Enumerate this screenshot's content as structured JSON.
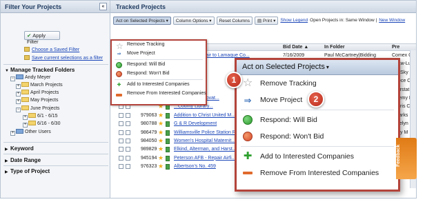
{
  "sidebar": {
    "title": "Filter Your Projects",
    "collapse_glyph": "«",
    "apply_label": "Apply Filter",
    "saved_filter_link": "Choose a Saved Filter",
    "save_current_link": "Save current selections as a filter",
    "manage_folders_title": "Manage Tracked Folders",
    "tree": [
      {
        "label": "Andy Meyer",
        "level": 0
      },
      {
        "label": "March Projects",
        "level": 1
      },
      {
        "label": "April Projects",
        "level": 1
      },
      {
        "label": "May Projects",
        "level": 1
      },
      {
        "label": "June Projects",
        "level": 1
      },
      {
        "label": "6/1 - 6/15",
        "level": 2
      },
      {
        "label": "6/16 - 6/30",
        "level": 2
      },
      {
        "label": "Other Users",
        "level": 0
      }
    ],
    "sections": [
      "Keyword",
      "Date Range",
      "Type of Project"
    ]
  },
  "main": {
    "title": "Tracked Projects",
    "toolbar": {
      "act_on": "Act on Selected Projects ▾",
      "column_options": "Column Options ▾",
      "reset_columns": "Reset Columns",
      "print": "Print ▾",
      "show_legend": "Show Legend",
      "open_projects_text": "Open Projects in: Same Window |",
      "new_window": "New Window"
    },
    "grid_headers": {
      "bid_date": "Bid Date ▲",
      "in_folder": "In Folder",
      "other": "Pre"
    },
    "rows": [
      {
        "num": "",
        "title": "...nance & Repair to Lamaque Co...",
        "date": "7/16/2009",
        "folder": "Paul McCartney|Bidding",
        "other": "Comex C"
      },
      {
        "num": "",
        "title": "...Townhomes",
        "date": "",
        "folder": "...na Harris",
        "other": "Shaw-Lu"
      },
      {
        "num": "",
        "title": "...s - Berks C...",
        "date": "",
        "folder": "",
        "other": "Big Sky C"
      },
      {
        "num": "",
        "title": "",
        "date": "",
        "folder": "",
        "other": "Reece Ca"
      },
      {
        "num": "",
        "title": "...ion Schr...",
        "date": "",
        "folder": "",
        "other": "Interstat"
      },
      {
        "num": "",
        "title": "...h House Renovat...",
        "date": "",
        "folder": "",
        "other": "Jeremy H"
      },
      {
        "num": "",
        "title": "...County Library...",
        "date": "",
        "folder": "",
        "other": "Morris C"
      },
      {
        "num": "979063",
        "title": "Addition to Christ United M...",
        "date": "",
        "folder": "",
        "other": "J Parks"
      },
      {
        "num": "980788",
        "title": "G & R Development",
        "date": "",
        "folder": "",
        "other": "Jocelyn"
      },
      {
        "num": "986479",
        "title": "Williamsville Police Station R...",
        "date": "",
        "folder": "",
        "other": "Jerry M"
      },
      {
        "num": "984050",
        "title": "Women's Hospital Maternit...",
        "date": "",
        "folder": "",
        "other": "Ho"
      },
      {
        "num": "989829",
        "title": "Elkind, Alterman, and Harst...",
        "date": "",
        "folder": "",
        "other": ""
      },
      {
        "num": "945194",
        "title": "Peterson AFB - Repair Airfi...",
        "date": "",
        "folder": "",
        "other": ""
      },
      {
        "num": "976323",
        "title": "Albertson's No. 459",
        "date": "",
        "folder": "",
        "other": ""
      }
    ]
  },
  "small_menu": {
    "items": [
      {
        "label": "Remove Tracking",
        "icon": "star-icon"
      },
      {
        "label": "Move Project",
        "icon": "move-icon"
      },
      {
        "label": "Respond: Will Bid",
        "icon": "green-circle-icon"
      },
      {
        "label": "Respond: Won't Bid",
        "icon": "red-circle-icon"
      },
      {
        "label": "Add to Interested Companies",
        "icon": "plus-icon"
      },
      {
        "label": "Remove From Interested Companies",
        "icon": "minus-icon"
      }
    ]
  },
  "big_menu": {
    "title": "Act on Selected Projects",
    "caret": "▾",
    "items": [
      {
        "label": "Remove Tracking"
      },
      {
        "label": "Move Project"
      },
      {
        "label": "Respond: Will Bid"
      },
      {
        "label": "Respond: Won't Bid"
      },
      {
        "label": "Add to Interested Companies"
      },
      {
        "label": "Remove From Interested Companies"
      }
    ]
  },
  "badges": {
    "one": "1",
    "two": "2"
  },
  "feedback_label": "Feedback",
  "colors": {
    "highlight_border": "#b3433a",
    "badge": "#c6321f",
    "link": "#1a45b8"
  }
}
